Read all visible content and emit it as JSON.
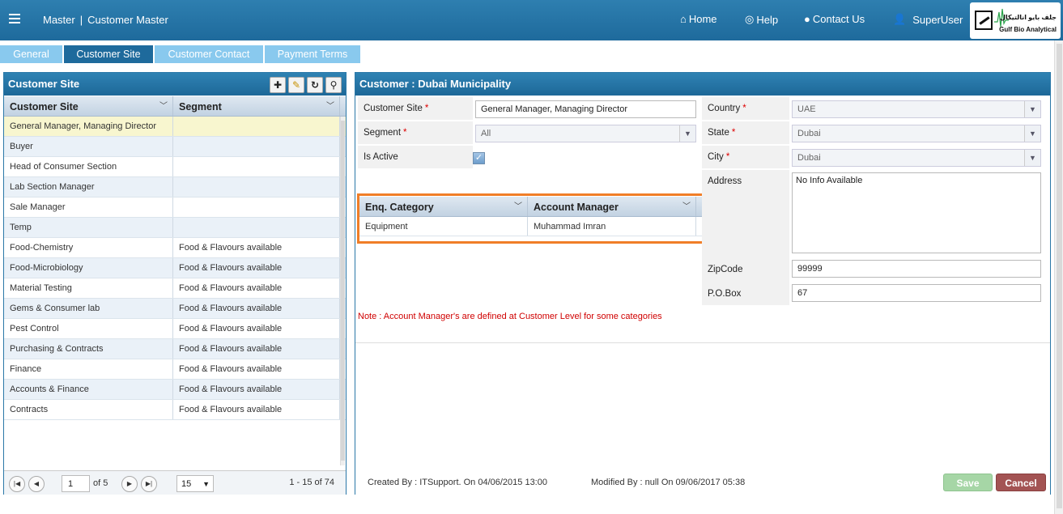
{
  "header": {
    "breadcrumb_root": "Master",
    "breadcrumb_page": "Customer Master",
    "nav": {
      "home": "Home",
      "help": "Help",
      "contact": "Contact Us",
      "user": "SuperUser"
    },
    "logo": {
      "arabic": "جلف بايو انالتيكال",
      "english": "Gulf Bio Analytical"
    }
  },
  "tabs": [
    "General",
    "Customer Site",
    "Customer Contact",
    "Payment Terms"
  ],
  "left_panel": {
    "title": "Customer Site",
    "columns": [
      "Customer Site",
      "Segment"
    ],
    "rows": [
      [
        "General Manager, Managing Director",
        ""
      ],
      [
        "Buyer",
        ""
      ],
      [
        "Head of Consumer Section",
        ""
      ],
      [
        "Lab Section Manager",
        ""
      ],
      [
        "Sale Manager",
        ""
      ],
      [
        "Temp",
        ""
      ],
      [
        "Food-Chemistry",
        "Food & Flavours available"
      ],
      [
        "Food-Microbiology",
        "Food & Flavours available"
      ],
      [
        "Material Testing",
        "Food & Flavours available"
      ],
      [
        "Gems & Consumer lab",
        "Food & Flavours available"
      ],
      [
        "Pest Control",
        "Food & Flavours available"
      ],
      [
        "Purchasing & Contracts",
        "Food & Flavours available"
      ],
      [
        "Finance",
        "Food & Flavours available"
      ],
      [
        "Accounts & Finance",
        "Food & Flavours available"
      ],
      [
        "Contracts",
        "Food & Flavours available"
      ]
    ],
    "pager": {
      "page": "1",
      "of": "of 5",
      "page_size": "15",
      "info": "1 - 15 of 74"
    }
  },
  "right_panel": {
    "title": "Customer : Dubai Municipality",
    "fields": {
      "customer_site_label": "Customer Site",
      "customer_site_value": "General Manager, Managing Director",
      "segment_label": "Segment",
      "segment_value": "All",
      "is_active_label": "Is Active",
      "country_label": "Country",
      "country_value": "UAE",
      "state_label": "State",
      "state_value": "Dubai",
      "city_label": "City",
      "city_value": "Dubai",
      "address_label": "Address",
      "address_value": "No Info Available",
      "zipcode_label": "ZipCode",
      "zipcode_value": "99999",
      "pobox_label": "P.O.Box",
      "pobox_value": "67"
    },
    "sub_grid": {
      "columns": [
        "Enq. Category",
        "Account Manager"
      ],
      "rows": [
        [
          "Equipment",
          "Muhammad Imran"
        ]
      ]
    },
    "note": "Note : Account Manager's are defined at Customer Level for some categories",
    "footer": {
      "created": "Created By : ITSupport. On 04/06/2015 13:00",
      "modified": "Modified By : null On 09/06/2017 05:38",
      "save": "Save",
      "cancel": "Cancel"
    }
  },
  "colors": {
    "header_blue": "#1e6a9c",
    "tab_light": "#89c9ee",
    "highlight_orange": "#f07e28",
    "note_red": "#d00000"
  }
}
